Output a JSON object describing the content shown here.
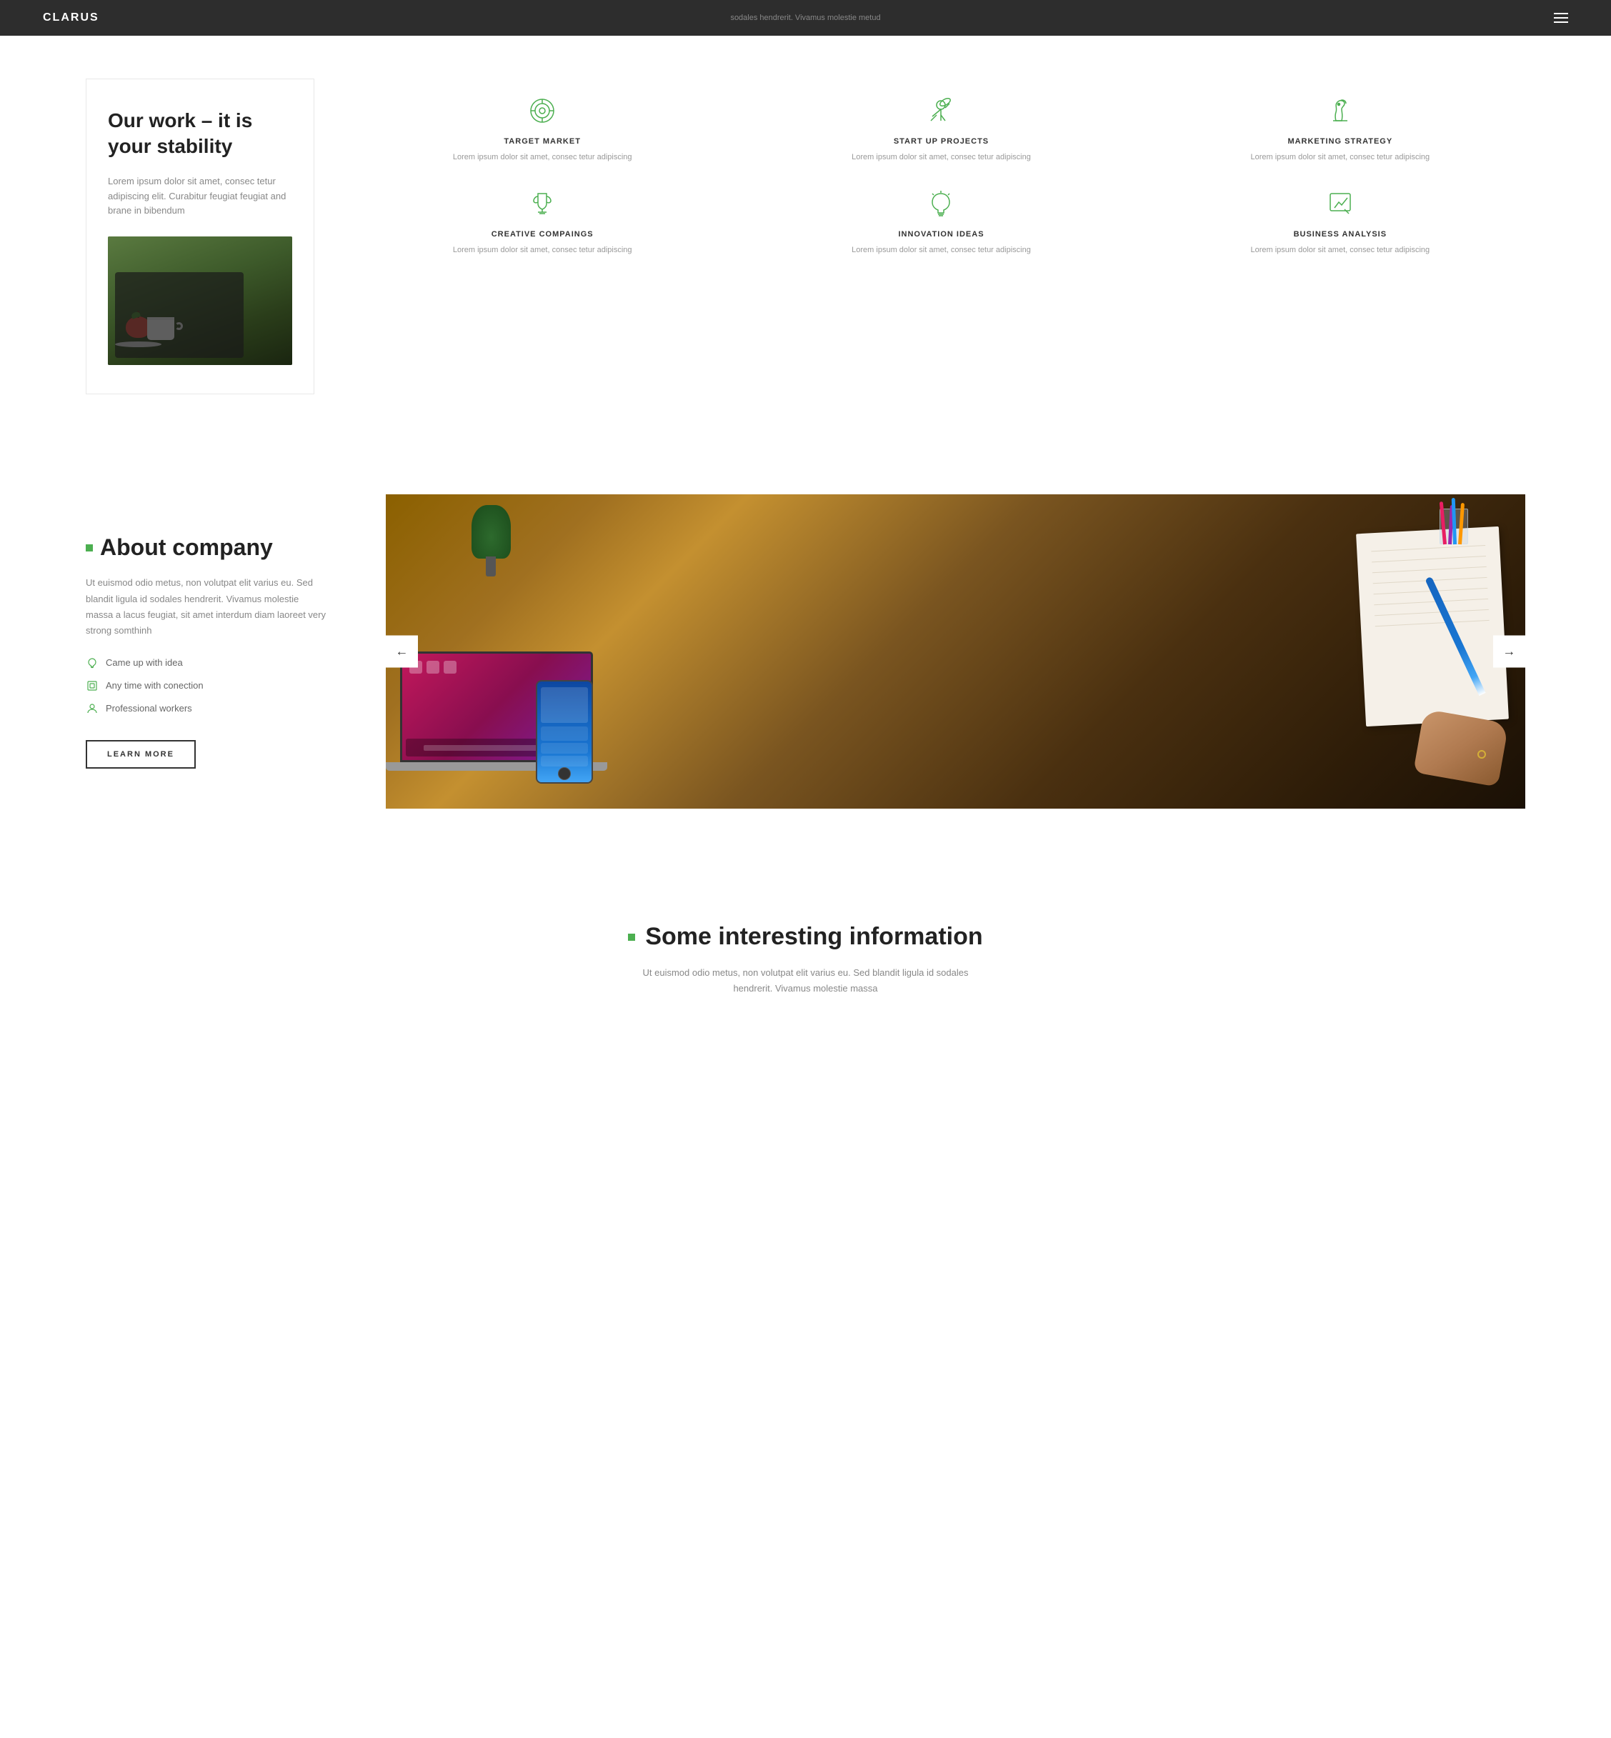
{
  "header": {
    "logo": "CLARUS",
    "subtitle": "sodales hendrerit. Vivamus molestie metud"
  },
  "our_work": {
    "title": "Our work – it is your stability",
    "description": "Lorem ipsum dolor sit amet, consec tetur adipiscing elit. Curabitur feugiat feugiat and brane in bibendum",
    "services": [
      {
        "name": "TARGET MARKET",
        "description": "Lorem ipsum dolor sit amet, consec tetur adipiscing",
        "icon": "target"
      },
      {
        "name": "START UP PROJECTS",
        "description": "Lorem ipsum dolor sit amet, consec tetur adipiscing",
        "icon": "telescope"
      },
      {
        "name": "MARKETING STRATEGY",
        "description": "Lorem ipsum dolor sit amet, consec tetur adipiscing",
        "icon": "chess-horse"
      },
      {
        "name": "CREATIVE COMPAINGS",
        "description": "Lorem ipsum dolor sit amet, consec tetur adipiscing",
        "icon": "trophy"
      },
      {
        "name": "INNOVATION IDEAS",
        "description": "Lorem ipsum dolor sit amet, consec tetur adipiscing",
        "icon": "lightbulb"
      },
      {
        "name": "BUSINESS ANALYSIS",
        "description": "Lorem ipsum dolor sit amet, consec tetur adipiscing",
        "icon": "chart"
      }
    ]
  },
  "about": {
    "heading": "About company",
    "description": "Ut euismod odio metus, non volutpat elit varius eu. Sed blandit ligula id sodales hendrerit. Vivamus molestie massa a lacus feugiat, sit amet interdum diam laoreet very strong somthinh",
    "features": [
      {
        "text": "Came up with idea",
        "icon": "lightbulb-small"
      },
      {
        "text": "Any time with conection",
        "icon": "square-icon"
      },
      {
        "text": "Professional workers",
        "icon": "person-icon"
      }
    ],
    "button_label": "LEARN MORE",
    "nav_left": "←",
    "nav_right": "→"
  },
  "interesting_info": {
    "heading": "Some interesting information",
    "description": "Ut euismod odio metus, non volutpat elit varius eu. Sed blandit ligula id sodales hendrerit. Vivamus molestie massa"
  }
}
